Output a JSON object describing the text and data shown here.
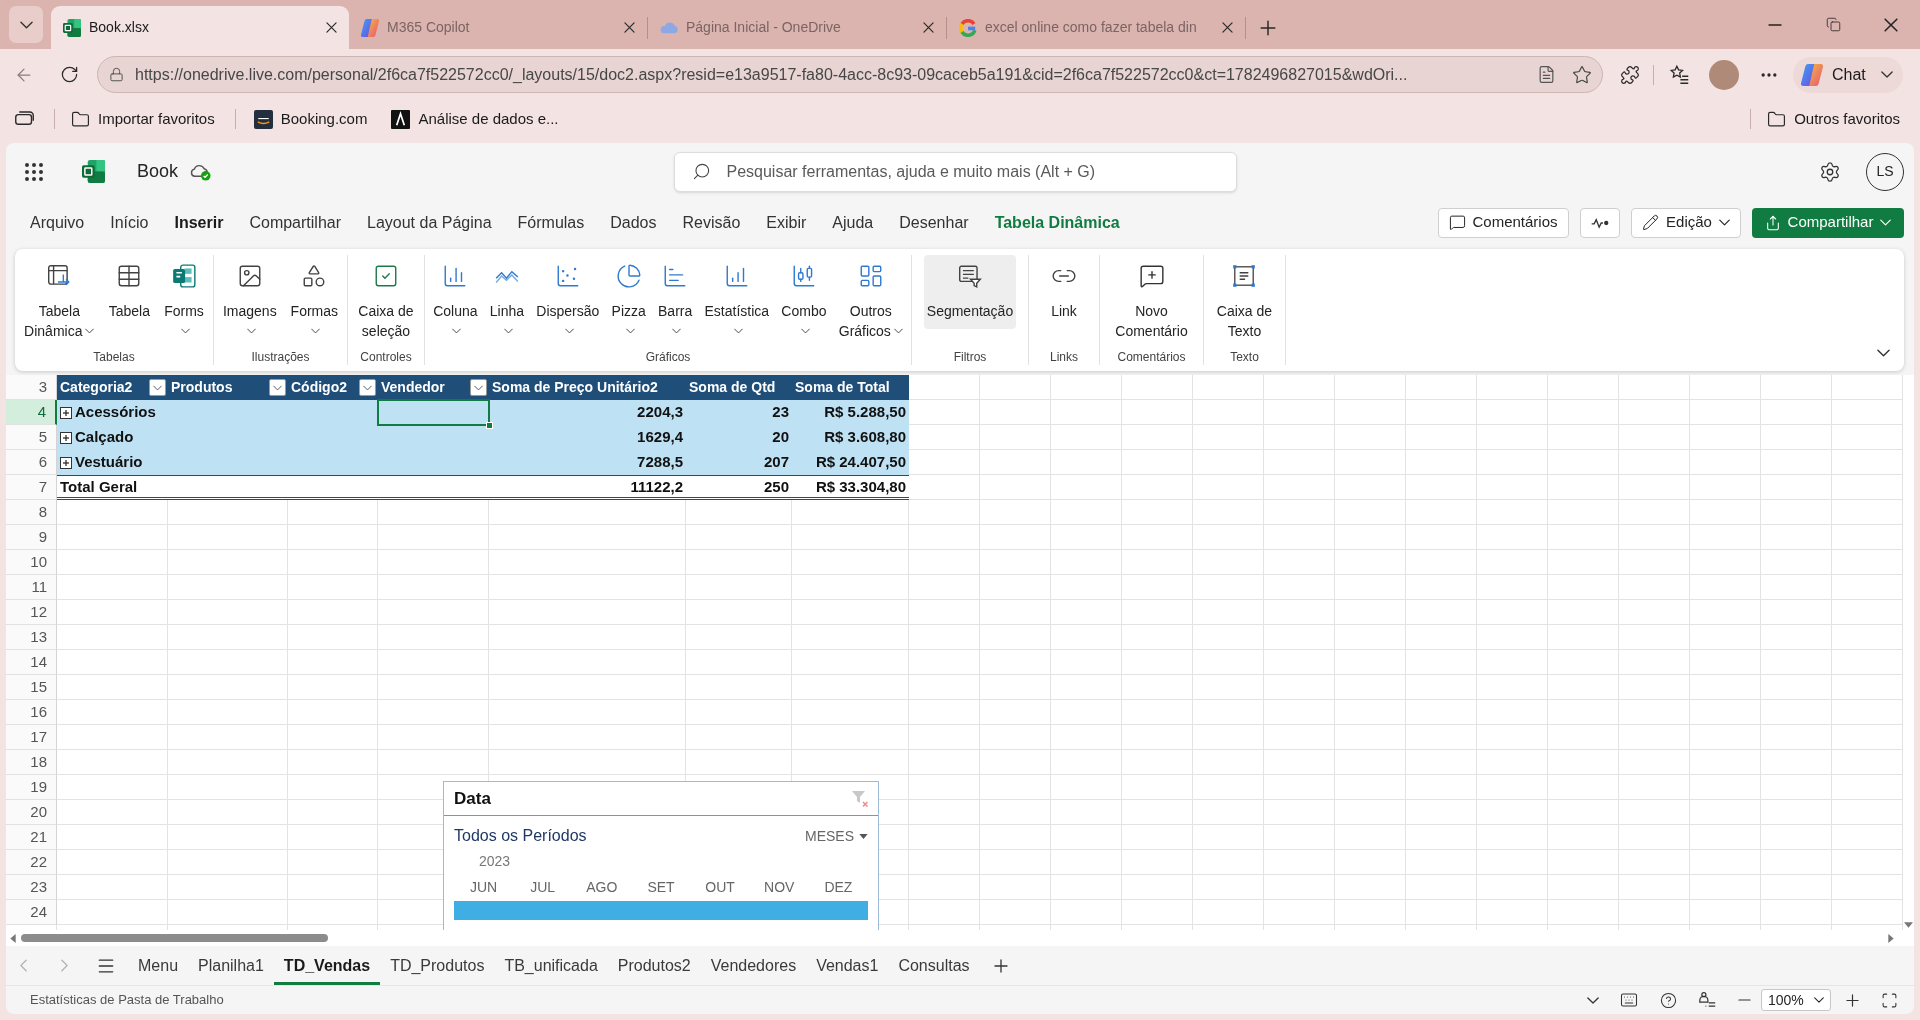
{
  "browser": {
    "tabs": [
      {
        "title": "Book.xlsx",
        "selected": true
      },
      {
        "title": "M365 Copilot",
        "selected": false
      },
      {
        "title": "Página Inicial - OneDrive",
        "selected": false
      },
      {
        "title": "excel online como fazer tabela din",
        "selected": false
      }
    ],
    "address": "https://onedrive.live.com/personal/2f6ca7f522572cc0/_layouts/15/doc2.aspx?resid=e13a9517-fa80-4acc-8c93-09caceb5a191&cid=2f6ca7f522572cc0&ct=1782496827015&wdOri...",
    "chat": "Chat",
    "bookmarks": [
      "Importar favoritos",
      "Booking.com",
      "Análise de dados e..."
    ],
    "other_bookmarks": "Outros favoritos"
  },
  "app": {
    "file_name": "Book",
    "search": {
      "placeholder": "Pesquisar ferramentas, ajuda e muito mais (Alt + G)"
    },
    "user_initials": "LS",
    "menu_tabs": [
      {
        "label": "Arquivo",
        "selected": false,
        "contextual": false
      },
      {
        "label": "Início",
        "selected": false,
        "contextual": false
      },
      {
        "label": "Inserir",
        "selected": true,
        "contextual": false
      },
      {
        "label": "Compartilhar",
        "selected": false,
        "contextual": false
      },
      {
        "label": "Layout da Página",
        "selected": false,
        "contextual": false
      },
      {
        "label": "Fórmulas",
        "selected": false,
        "contextual": false
      },
      {
        "label": "Dados",
        "selected": false,
        "contextual": false
      },
      {
        "label": "Revisão",
        "selected": false,
        "contextual": false
      },
      {
        "label": "Exibir",
        "selected": false,
        "contextual": false
      },
      {
        "label": "Ajuda",
        "selected": false,
        "contextual": false
      },
      {
        "label": "Desenhar",
        "selected": false,
        "contextual": false
      },
      {
        "label": "Tabela Dinâmica",
        "selected": false,
        "contextual": true
      }
    ],
    "actions": {
      "comments": "Comentários",
      "mode": "Edição",
      "share": "Compartilhar"
    },
    "ribbon": [
      {
        "label": "Tabelas",
        "buttons": [
          {
            "lines": [
              "Tabela",
              "Dinâmica"
            ],
            "dropdown": true,
            "highlighted": false
          },
          {
            "lines": [
              "Tabela"
            ],
            "dropdown": false,
            "highlighted": false
          },
          {
            "lines": [
              "Forms"
            ],
            "dropdown": true,
            "highlighted": false
          }
        ]
      },
      {
        "label": "Ilustrações",
        "buttons": [
          {
            "lines": [
              "Imagens"
            ],
            "dropdown": true,
            "highlighted": false
          },
          {
            "lines": [
              "Formas"
            ],
            "dropdown": true,
            "highlighted": false
          }
        ]
      },
      {
        "label": "Controles",
        "buttons": [
          {
            "lines": [
              "Caixa de",
              "seleção"
            ],
            "dropdown": false,
            "highlighted": false
          }
        ]
      },
      {
        "label": "Gráficos",
        "buttons": [
          {
            "lines": [
              "Coluna"
            ],
            "dropdown": true,
            "highlighted": false
          },
          {
            "lines": [
              "Linha"
            ],
            "dropdown": true,
            "highlighted": false
          },
          {
            "lines": [
              "Dispersão"
            ],
            "dropdown": true,
            "highlighted": false
          },
          {
            "lines": [
              "Pizza"
            ],
            "dropdown": true,
            "highlighted": false
          },
          {
            "lines": [
              "Barra"
            ],
            "dropdown": true,
            "highlighted": false
          },
          {
            "lines": [
              "Estatística"
            ],
            "dropdown": true,
            "highlighted": false
          },
          {
            "lines": [
              "Combo"
            ],
            "dropdown": true,
            "highlighted": false
          },
          {
            "lines": [
              "Outros",
              "Gráficos"
            ],
            "dropdown": true,
            "highlighted": false
          }
        ]
      },
      {
        "label": "Filtros",
        "buttons": [
          {
            "lines": [
              "Segmentação"
            ],
            "dropdown": false,
            "highlighted": true
          }
        ]
      },
      {
        "label": "Links",
        "buttons": [
          {
            "lines": [
              "Link"
            ],
            "dropdown": false,
            "highlighted": false
          }
        ]
      },
      {
        "label": "Comentários",
        "buttons": [
          {
            "lines": [
              "Novo",
              "Comentário"
            ],
            "dropdown": false,
            "highlighted": false
          }
        ]
      },
      {
        "label": "Texto",
        "buttons": [
          {
            "lines": [
              "Caixa de",
              "Texto"
            ],
            "dropdown": false,
            "highlighted": false
          }
        ]
      }
    ],
    "row_numbers": [
      {
        "label": "3",
        "selected": false
      },
      {
        "label": "4",
        "selected": true
      },
      {
        "label": "5",
        "selected": false
      },
      {
        "label": "6",
        "selected": false
      },
      {
        "label": "7",
        "selected": false
      },
      {
        "label": "8",
        "selected": false
      },
      {
        "label": "9",
        "selected": false
      },
      {
        "label": "10",
        "selected": false
      },
      {
        "label": "11",
        "selected": false
      },
      {
        "label": "12",
        "selected": false
      },
      {
        "label": "13",
        "selected": false
      },
      {
        "label": "14",
        "selected": false
      },
      {
        "label": "15",
        "selected": false
      },
      {
        "label": "16",
        "selected": false
      },
      {
        "label": "17",
        "selected": false
      },
      {
        "label": "18",
        "selected": false
      },
      {
        "label": "19",
        "selected": false
      },
      {
        "label": "20",
        "selected": false
      },
      {
        "label": "21",
        "selected": false
      },
      {
        "label": "22",
        "selected": false
      },
      {
        "label": "23",
        "selected": false
      },
      {
        "label": "24",
        "selected": false
      }
    ],
    "pivot": {
      "headers": [
        {
          "label": "Categoria2",
          "filter": true
        },
        {
          "label": "Produtos",
          "filter": true
        },
        {
          "label": "Código2",
          "filter": true
        },
        {
          "label": "Vendedor",
          "filter": true
        },
        {
          "label": "Soma de Preço Unitário2",
          "filter": false
        },
        {
          "label": "Soma de Qtd",
          "filter": false
        },
        {
          "label": "Soma de Total",
          "filter": false
        }
      ],
      "rows": [
        {
          "label": "Acessórios",
          "expanded": false,
          "selected": true,
          "values": [
            "2204,3",
            "23",
            "R$ 5.288,50"
          ]
        },
        {
          "label": "Calçado",
          "expanded": false,
          "selected": false,
          "values": [
            "1629,4",
            "20",
            "R$ 3.608,80"
          ]
        },
        {
          "label": "Vestuário",
          "expanded": false,
          "selected": false,
          "values": [
            "7288,5",
            "207",
            "R$ 24.407,50"
          ]
        }
      ],
      "total": {
        "label": "Total Geral",
        "values": [
          "11122,2",
          "250",
          "R$ 33.304,80"
        ]
      }
    },
    "timeline": {
      "title": "Data",
      "period": "Todos os Períodos",
      "level_label": "MESES",
      "year": "2023",
      "months": [
        {
          "label": "JUN",
          "selected": true
        },
        {
          "label": "JUL",
          "selected": true
        },
        {
          "label": "AGO",
          "selected": true
        },
        {
          "label": "SET",
          "selected": true
        },
        {
          "label": "OUT",
          "selected": true
        },
        {
          "label": "NOV",
          "selected": true
        },
        {
          "label": "DEZ",
          "selected": true
        }
      ]
    },
    "sheet_tabs": [
      {
        "label": "Menu",
        "selected": false
      },
      {
        "label": "Planilha1",
        "selected": false
      },
      {
        "label": "TD_Vendas",
        "selected": true
      },
      {
        "label": "TD_Produtos",
        "selected": false
      },
      {
        "label": "TB_unificada",
        "selected": false
      },
      {
        "label": "Produtos2",
        "selected": false
      },
      {
        "label": "Vendedores",
        "selected": false
      },
      {
        "label": "Vendas1",
        "selected": false
      },
      {
        "label": "Consultas",
        "selected": false
      }
    ],
    "status_bar": {
      "text": "Estatísticas de Pasta de Trabalho",
      "zoom": "100%"
    }
  }
}
